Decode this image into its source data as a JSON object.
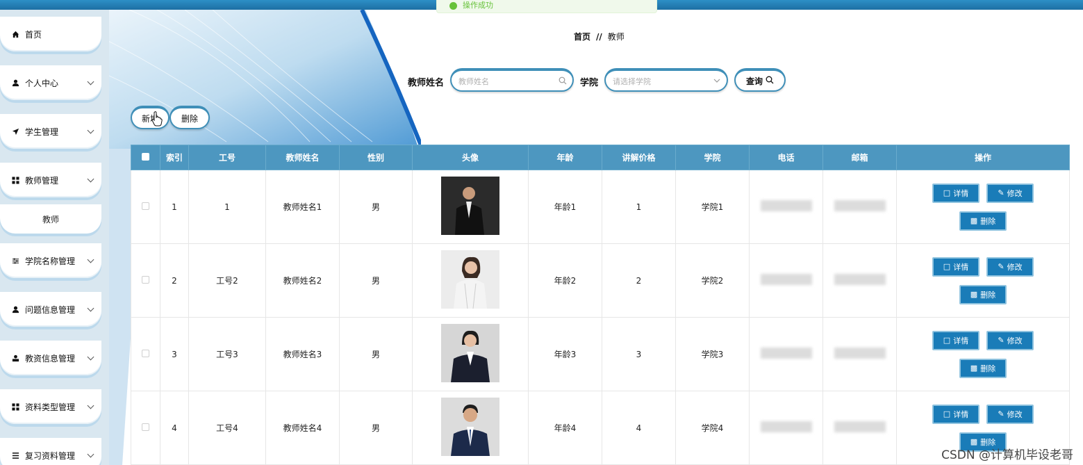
{
  "toast": {
    "message": "操作成功"
  },
  "sidebar": {
    "items": [
      {
        "label": "首页",
        "icon": "home-icon",
        "expandable": false
      },
      {
        "label": "个人中心",
        "icon": "user-icon",
        "expandable": true
      },
      {
        "label": "学生管理",
        "icon": "send-icon",
        "expandable": true
      },
      {
        "label": "教师管理",
        "icon": "grid-icon",
        "expandable": true
      },
      {
        "label": "学院名称管理",
        "icon": "sliders-icon",
        "expandable": true
      },
      {
        "label": "问题信息管理",
        "icon": "user-icon",
        "expandable": true
      },
      {
        "label": "教资信息管理",
        "icon": "user-stamp-icon",
        "expandable": true
      },
      {
        "label": "资料类型管理",
        "icon": "grid-icon",
        "expandable": true
      },
      {
        "label": "复习资料管理",
        "icon": "list-icon",
        "expandable": true
      }
    ],
    "sub_item": "教师"
  },
  "breadcrumb": {
    "home": "首页",
    "separator": "//",
    "current": "教师"
  },
  "search": {
    "name_label": "教师姓名",
    "name_placeholder": "教师姓名",
    "college_label": "学院",
    "college_placeholder": "请选择学院",
    "query_label": "查询"
  },
  "toolbar": {
    "add_label": "新增",
    "delete_label": "删除"
  },
  "table": {
    "headers": [
      "索引",
      "工号",
      "教师姓名",
      "性别",
      "头像",
      "年龄",
      "讲解价格",
      "学院",
      "电话",
      "邮箱",
      "操作"
    ],
    "rows": [
      {
        "index": "1",
        "id": "1",
        "name": "教师姓名1",
        "gender": "男",
        "age": "年龄1",
        "price": "1",
        "college": "学院1"
      },
      {
        "index": "2",
        "id": "工号2",
        "name": "教师姓名2",
        "gender": "男",
        "age": "年龄2",
        "price": "2",
        "college": "学院2"
      },
      {
        "index": "3",
        "id": "工号3",
        "name": "教师姓名3",
        "gender": "男",
        "age": "年龄3",
        "price": "3",
        "college": "学院3"
      },
      {
        "index": "4",
        "id": "工号4",
        "name": "教师姓名4",
        "gender": "男",
        "age": "年龄4",
        "price": "4",
        "college": "学院4"
      }
    ],
    "actions": {
      "detail": "详情",
      "edit": "修改",
      "delete": "删除"
    }
  },
  "watermark": "CSDN @计算机毕设老哥",
  "colors": {
    "accent": "#1a7cb8",
    "header": "#4d97c0",
    "success": "#67c23a"
  }
}
